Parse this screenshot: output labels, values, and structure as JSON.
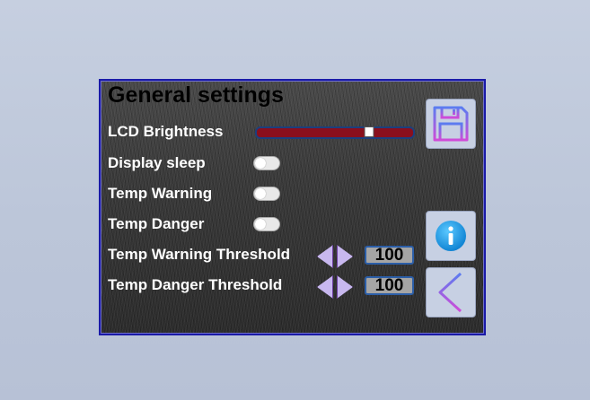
{
  "title": "General settings",
  "settings": {
    "lcd_brightness": {
      "label": "LCD Brightness",
      "value_fraction": 0.72
    },
    "display_sleep": {
      "label": "Display sleep",
      "enabled": false
    },
    "temp_warning": {
      "label": "Temp Warning",
      "enabled": false
    },
    "temp_danger": {
      "label": "Temp Danger",
      "enabled": false
    },
    "temp_warning_threshold": {
      "label": "Temp Warning Threshold",
      "value": "100"
    },
    "temp_danger_threshold": {
      "label": "Temp Danger Threshold",
      "value": "100"
    }
  },
  "buttons": {
    "save": {
      "icon": "floppy-disk-icon"
    },
    "info": {
      "icon": "info-icon"
    },
    "back": {
      "icon": "chevron-left-icon"
    }
  },
  "colors": {
    "slider_fill": "#8a0f1d",
    "slider_border": "#1c3f7d",
    "arrow_fill": "#c8b8ef",
    "value_box_border": "#2b5ea8",
    "info_blue": "#1ea0e6"
  }
}
